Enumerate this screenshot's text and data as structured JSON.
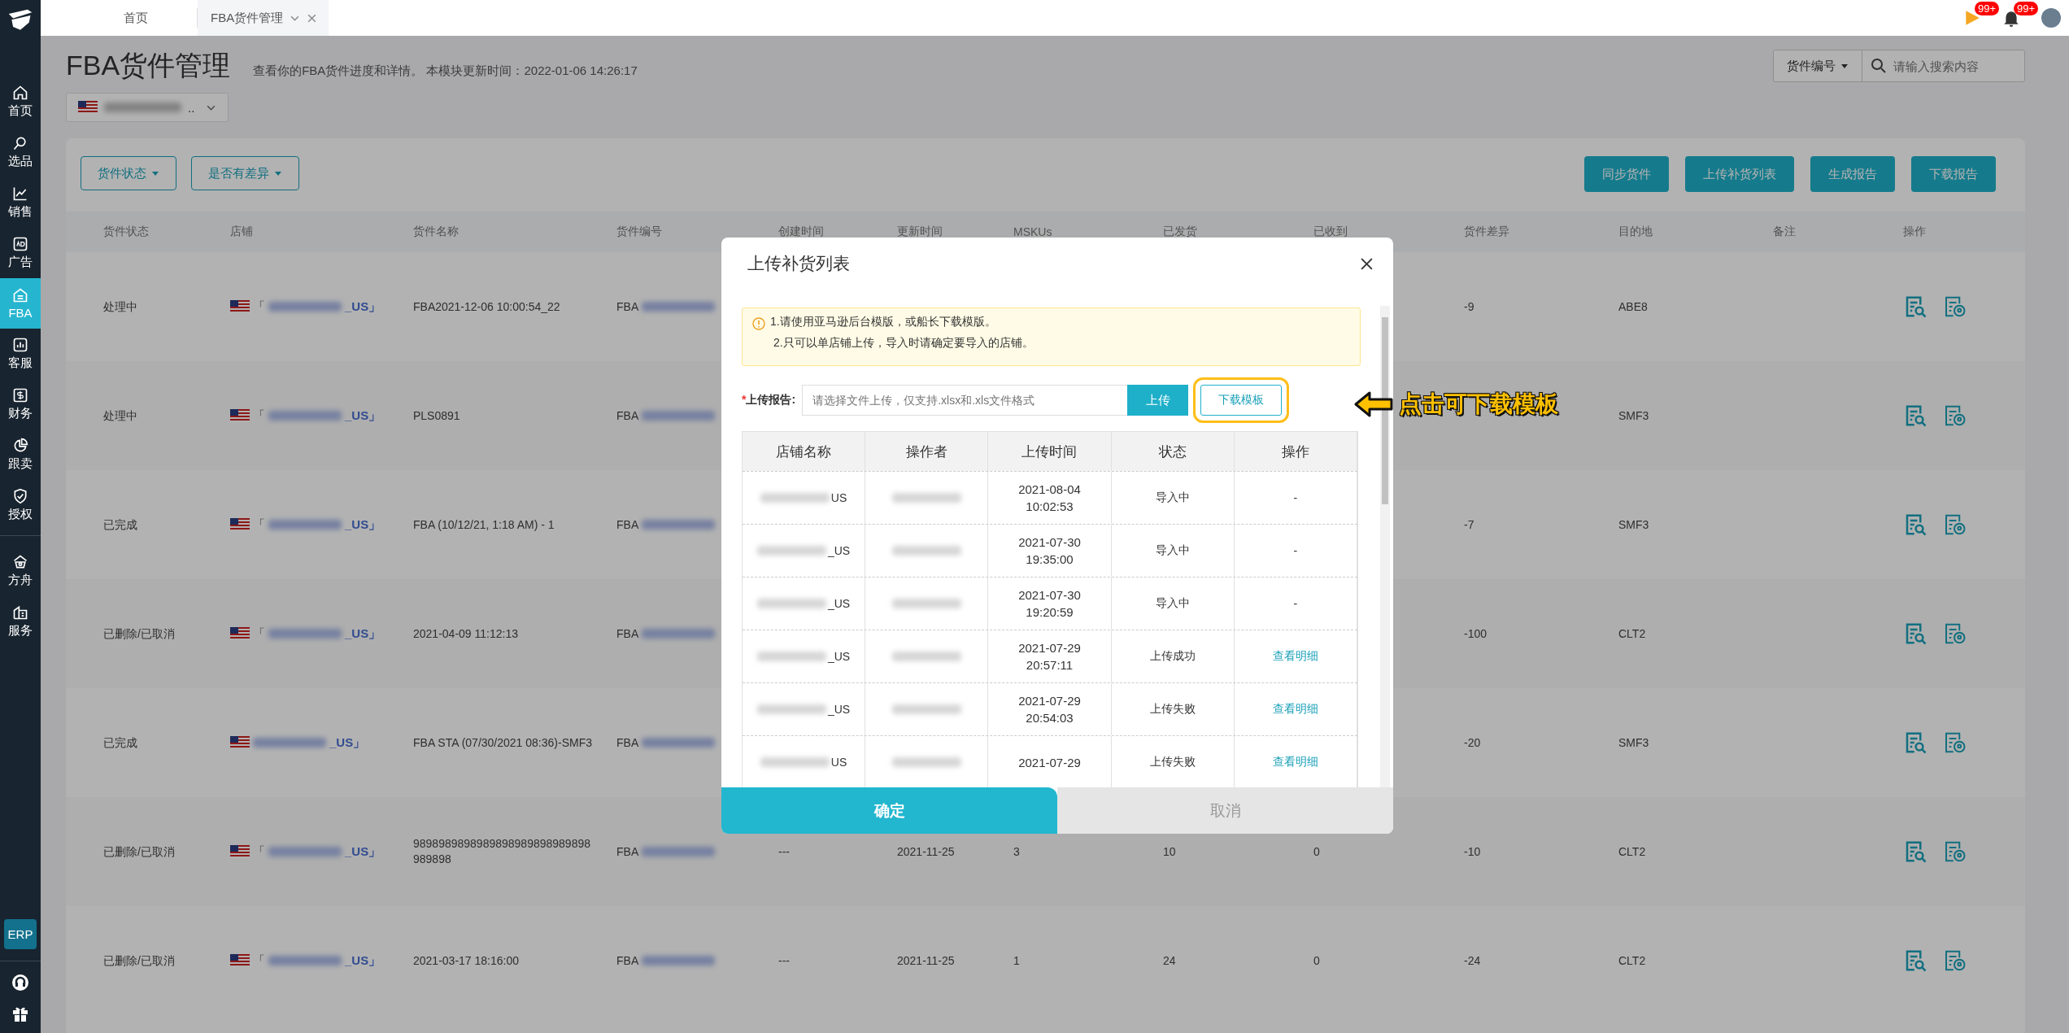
{
  "sidebar": {
    "items": [
      {
        "label": "首页",
        "selected": false
      },
      {
        "label": "选品",
        "selected": false
      },
      {
        "label": "销售",
        "selected": false
      },
      {
        "label": "广告",
        "selected": false
      },
      {
        "label": "FBA",
        "selected": true
      },
      {
        "label": "客服",
        "selected": false
      },
      {
        "label": "财务",
        "selected": false
      },
      {
        "label": "跟卖",
        "selected": false
      },
      {
        "label": "授权",
        "selected": false
      },
      {
        "label": "方舟",
        "selected": false
      },
      {
        "label": "服务",
        "selected": false
      }
    ],
    "badge": "ERP"
  },
  "tabs": [
    {
      "label": "首页",
      "selected": false
    },
    {
      "label": "FBA货件管理",
      "selected": true
    }
  ],
  "notifications": [
    {
      "kind": "flag",
      "count": "99+"
    },
    {
      "kind": "bell",
      "count": "99+"
    }
  ],
  "header": {
    "title": "FBA货件管理",
    "subtitle": "查看你的FBA货件进度和详情。 本模块更新时间：2022-01-06 14:26:17",
    "store_suffix": ".."
  },
  "search": {
    "field": "货件编号",
    "placeholder": "请输入搜索内容"
  },
  "filters": [
    "货件状态",
    "是否有差异"
  ],
  "actions": [
    "同步货件",
    "上传补货列表",
    "生成报告",
    "下载报告"
  ],
  "table": {
    "columns": [
      "货件状态",
      "店铺",
      "货件名称",
      "货件编号",
      "创建时间",
      "更新时间",
      "MSKUs",
      "已发货",
      "已收到",
      "货件差异",
      "目的地",
      "备注",
      "操作"
    ],
    "rows": [
      {
        "status": "处理中",
        "store_open": "「",
        "store_close": "_US」",
        "name": "FBA2021-12-06 10:00:54_22",
        "shipment": "FBA",
        "diff": "-9",
        "destination": "ABE8"
      },
      {
        "status": "处理中",
        "store_open": "「",
        "store_close": "_US」",
        "name": "PLS0891",
        "shipment": "FBA",
        "destination": "SMF3"
      },
      {
        "status": "已完成",
        "store_open": "「",
        "store_close": "_US」",
        "name": "FBA (10/12/21, 1:18 AM) - 1",
        "shipment": "FBA",
        "diff": "-7",
        "destination": "SMF3"
      },
      {
        "status": "已删除/已取消",
        "store_open": "「",
        "store_close": "_US」",
        "name": "2021-04-09 11:12:13",
        "shipment": "FBA",
        "diff": "-100",
        "destination": "CLT2"
      },
      {
        "status": "已完成",
        "store_close": "_US」",
        "name": "FBA STA (07/30/2021 08:36)-SMF3",
        "shipment": "FBA",
        "diff": "-20",
        "destination": "SMF3"
      },
      {
        "status": "已删除/已取消",
        "store_open": "「",
        "store_close": "_US」",
        "name": "9898989898989898989898989898989898",
        "shipment": "FBA",
        "created": "---",
        "updated": "2021-11-25",
        "mskus": "3",
        "shipped": "10",
        "received": "0",
        "diff": "-10",
        "destination": "CLT2"
      },
      {
        "status": "已删除/已取消",
        "store_open": "「",
        "store_close": "_US」",
        "name": "2021-03-17 18:16:00",
        "shipment": "FBA",
        "created": "---",
        "updated": "2021-11-25",
        "mskus": "1",
        "shipped": "24",
        "received": "0",
        "diff": "-24",
        "destination": "CLT2"
      }
    ]
  },
  "dialog": {
    "title": "上传补货列表",
    "notes": [
      "1.请使用亚马逊后台模版，或船长下载模版。",
      "2.只可以单店铺上传，导入时请确定要导入的店铺。"
    ],
    "upload_label": "上传报告:",
    "required_mark": "*",
    "file_placeholder": "请选择文件上传，仅支持.xlsx和.xls文件格式",
    "upload_button": "上传",
    "template_button": "下载模板",
    "columns": [
      "店铺名称",
      "操作者",
      "上传时间",
      "状态",
      "操作"
    ],
    "rows": [
      {
        "store": "US",
        "time": [
          "2021-08-04",
          "10:02:53"
        ],
        "status": "导入中",
        "action": "-",
        "kind": "text"
      },
      {
        "store": "_US",
        "time": [
          "2021-07-30",
          "19:35:00"
        ],
        "status": "导入中",
        "action": "-",
        "kind": "text"
      },
      {
        "store": "_US",
        "time": [
          "2021-07-30",
          "19:20:59"
        ],
        "status": "导入中",
        "action": "-",
        "kind": "text"
      },
      {
        "store": "_US",
        "time": [
          "2021-07-29",
          "20:57:11"
        ],
        "status": "上传成功",
        "action": "查看明细",
        "kind": "link"
      },
      {
        "store": "_US",
        "time": [
          "2021-07-29",
          "20:54:03"
        ],
        "status": "上传失败",
        "action": "查看明细",
        "kind": "link"
      },
      {
        "store": "US",
        "time": [
          "2021-07-29"
        ],
        "status": "上传失败",
        "action": "查看明细",
        "kind": "link"
      }
    ],
    "confirm": "确定",
    "cancel": "取消"
  },
  "annotation": {
    "text": "点击可下载模板"
  }
}
